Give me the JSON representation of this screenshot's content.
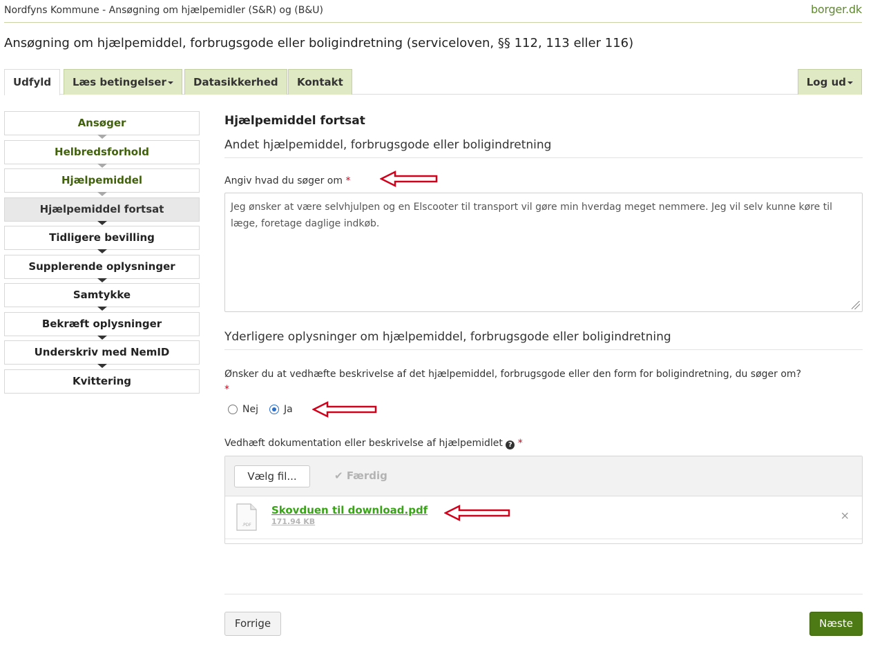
{
  "header": {
    "app_title": "Nordfyns Kommune - Ansøgning om hjælpemidler (S&R) og (B&U)",
    "brand": "borger.dk",
    "page_title": "Ansøgning om hjælpemiddel, forbrugsgode eller boligindretning (serviceloven, §§ 112, 113 eller 116)"
  },
  "tabs": [
    {
      "label": "Udfyld",
      "active": true
    },
    {
      "label": "Læs betingelser",
      "dropdown": true
    },
    {
      "label": "Datasikkerhed"
    },
    {
      "label": "Kontakt"
    }
  ],
  "logout": {
    "label": "Log ud"
  },
  "steps": [
    {
      "label": "Ansøger",
      "state": "done"
    },
    {
      "label": "Helbredsforhold",
      "state": "done"
    },
    {
      "label": "Hjælpemiddel",
      "state": "done"
    },
    {
      "label": "Hjælpemiddel fortsat",
      "state": "current"
    },
    {
      "label": "Tidligere bevilling"
    },
    {
      "label": "Supplerende oplysninger"
    },
    {
      "label": "Samtykke"
    },
    {
      "label": "Bekræft oplysninger"
    },
    {
      "label": "Underskriv med NemID"
    },
    {
      "label": "Kvittering"
    }
  ],
  "main": {
    "section_heading": "Hjælpemiddel fortsat",
    "sub_heading": "Andet hjælpemiddel, forbrugsgode eller boligindretning",
    "request_label": "Angiv hvad du søger om",
    "required_marker": "*",
    "request_text": "Jeg ønsker at være selvhjulpen og en Elscooter til transport vil gøre min hverdag meget nemmere. Jeg vil selv kunne køre til læge, foretage daglige indkøb.",
    "sub_heading2": "Yderligere oplysninger om hjælpemiddel, forbrugsgode eller boligindretning",
    "attach_question": "Ønsker du at vedhæfte beskrivelse af det hjælpemiddel, forbrugsgode eller den form for boligindretning, du søger om?",
    "radio_no": "Nej",
    "radio_yes": "Ja",
    "radio_selected": "Ja",
    "upload_label": "Vedhæft dokumentation eller beskrivelse af hjælpemidlet",
    "help_icon": "?",
    "choose_file": "Vælg fil...",
    "done_label": "Færdig",
    "file_name": "Skovduen til download.pdf",
    "file_size": "171.94 KB",
    "file_type": ".PDF",
    "remove_glyph": "×"
  },
  "footer": {
    "prev_label": "Forrige",
    "next_label": "Næste"
  },
  "colors": {
    "accent_green": "#4e7a16",
    "tab_green": "#dfe9c4",
    "link_green": "#3aa319",
    "annotation_red": "#d0021b"
  }
}
